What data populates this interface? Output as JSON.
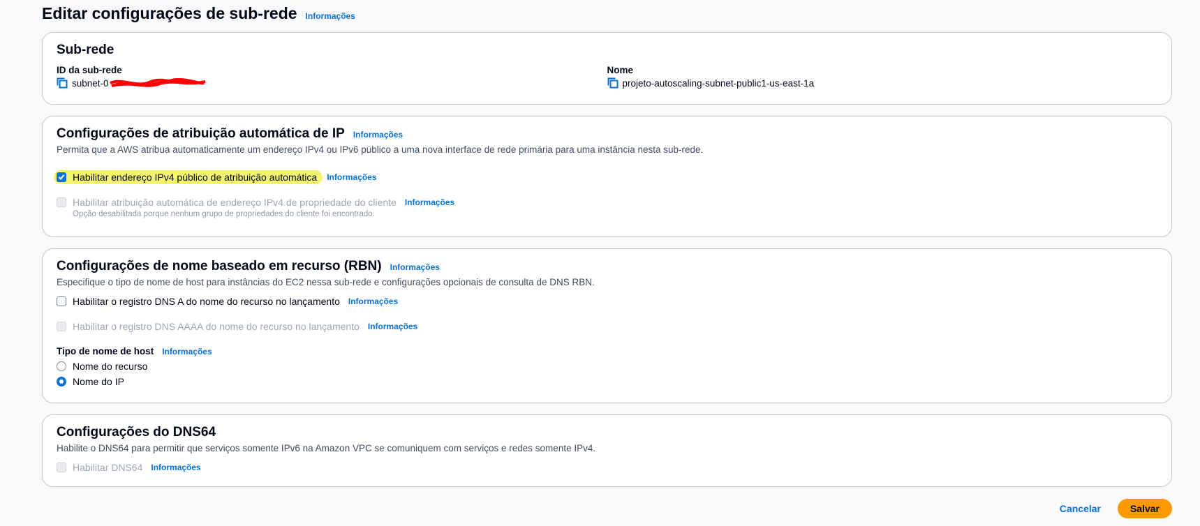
{
  "page": {
    "title": "Editar configurações de sub-rede",
    "info": "Informações"
  },
  "subnet": {
    "title": "Sub-rede",
    "id_label": "ID da sub-rede",
    "id_value": "subnet-0",
    "name_label": "Nome",
    "name_value": "projeto-autoscaling-subnet-public1-us-east-1a"
  },
  "ip_auto": {
    "title": "Configurações de atribuição automática de IP",
    "info": "Informações",
    "description": "Permita que a AWS atribua automaticamente um endereço IPv4 ou IPv6 público a uma nova interface de rede primária para uma instância nesta sub-rede.",
    "ipv4_label": "Habilitar endereço IPv4 público de atribuição automática",
    "ipv4_checked": true,
    "ipv4_info": "Informações",
    "coip_label": "Habilitar atribuição automática de endereço IPv4 de propriedade do cliente",
    "coip_info": "Informações",
    "coip_hint": "Opção desabilitada porque nenhum grupo de propriedades do cliente foi encontrado."
  },
  "rbn": {
    "title": "Configurações de nome baseado em recurso (RBN)",
    "info": "Informações",
    "description": "Especifique o tipo de nome de host para instâncias do EC2 nessa sub-rede e configurações opcionais de consulta de DNS RBN.",
    "dns_a_label": "Habilitar o registro DNS A do nome do recurso no lançamento",
    "dns_a_info": "Informações",
    "dns_aaaa_label": "Habilitar o registro DNS AAAA do nome do recurso no lançamento",
    "dns_aaaa_info": "Informações",
    "hostname_label": "Tipo de nome de host",
    "hostname_info": "Informações",
    "option_resource": "Nome do recurso",
    "option_ip": "Nome do IP",
    "selected": "Nome do IP"
  },
  "dns64": {
    "title": "Configurações do DNS64",
    "description": "Habilite o DNS64 para permitir que serviços somente IPv6 na Amazon VPC se comuniquem com serviços e redes somente IPv4.",
    "enable_label": "Habilitar DNS64",
    "enable_info": "Informações"
  },
  "footer": {
    "cancel": "Cancelar",
    "save": "Salvar"
  },
  "colors": {
    "accent": "#0972d3",
    "primary_button": "#ff9900",
    "highlight": "#f4f46f",
    "redaction": "#ff0000"
  }
}
